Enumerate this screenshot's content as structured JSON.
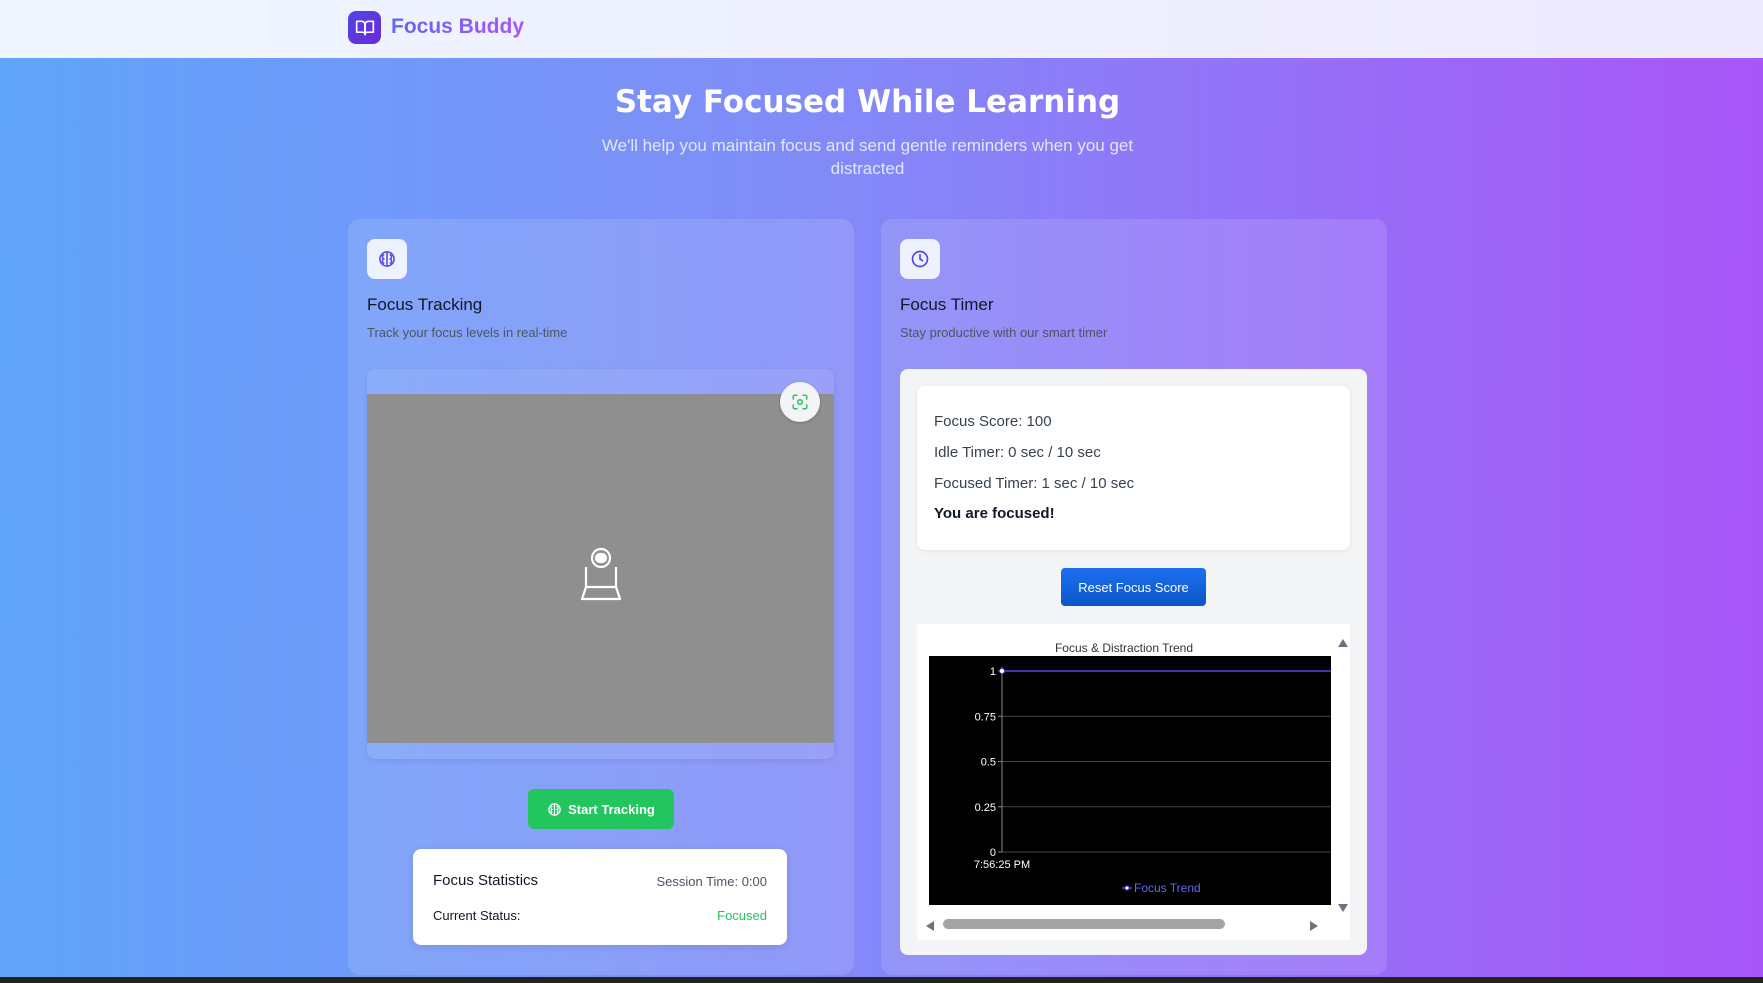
{
  "header": {
    "brand": "Focus Buddy",
    "logo_icon": "book-open-icon"
  },
  "hero": {
    "title": "Stay Focused While Learning",
    "subtitle": "We'll help you maintain focus and send gentle reminders when you get distracted"
  },
  "tracking_card": {
    "icon": "brain-icon",
    "title": "Focus Tracking",
    "subtitle": "Track your focus levels in real-time",
    "camera_icon": "webcam-icon",
    "capture_icon": "scan-face-icon",
    "start_button": "Start Tracking",
    "stats": {
      "title": "Focus Statistics",
      "session_time": "Session Time: 0:00",
      "status_label": "Current Status:",
      "status_value": "Focused"
    }
  },
  "timer_card": {
    "icon": "clock-icon",
    "title": "Focus Timer",
    "subtitle": "Stay productive with our smart timer",
    "focus_score": "Focus Score: 100",
    "idle_timer": "Idle Timer: 0 sec / 10 sec",
    "focused_timer": "Focused Timer: 1 sec / 10 sec",
    "status_message": "You are focused!",
    "reset_button": "Reset Focus Score"
  },
  "colors": {
    "accent_green": "#22c55e",
    "accent_blue": "#0a63e0",
    "brand_purple": "#6d28d9",
    "chart_line": "#4f46e5"
  },
  "chart_data": {
    "type": "line",
    "title": "Focus & Distraction Trend",
    "x": [
      "7:56:25 PM"
    ],
    "series": [
      {
        "name": "Focus Trend",
        "values": [
          1
        ]
      }
    ],
    "yticks": [
      "0",
      "0.25",
      "0.5",
      "0.75",
      "1"
    ],
    "ylim": [
      0,
      1
    ],
    "grid": true,
    "legend": "bottom"
  }
}
